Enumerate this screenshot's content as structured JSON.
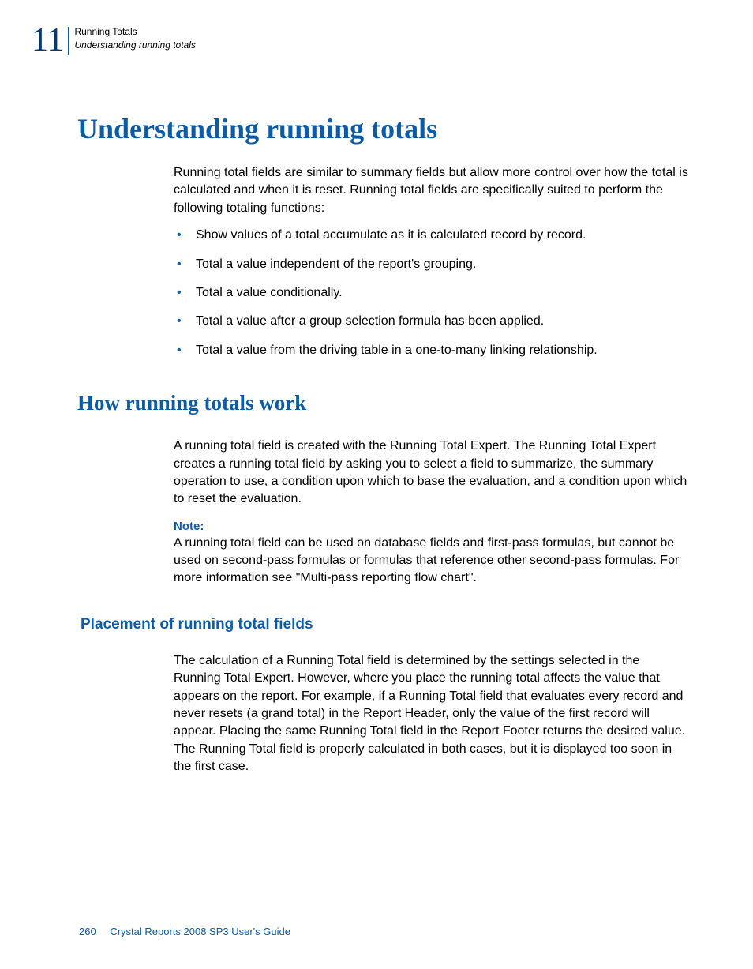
{
  "header": {
    "chapter_number": "11",
    "line1": "Running Totals",
    "line2": "Understanding running totals"
  },
  "title": "Understanding running totals",
  "intro": "Running total fields are similar to summary fields but allow more control over how the total is calculated and when it is reset. Running total fields are specifically suited to perform the following totaling functions:",
  "bullets": [
    "Show values of a total accumulate as it is calculated record by record.",
    "Total a value independent of the report's grouping.",
    "Total a value conditionally.",
    "Total a value after a group selection formula has been applied.",
    "Total a value from the driving table in a one-to-many linking relationship."
  ],
  "section2": {
    "title": "How running totals work",
    "para": "A running total field is created with the Running Total Expert. The Running Total Expert creates a running total field by asking you to select a field to summarize, the summary operation to use, a condition upon which to base the evaluation, and a condition upon which to reset the evaluation.",
    "note_label": "Note:",
    "note_body": "A running total field can be used on database fields and first-pass formulas, but cannot be used on second-pass formulas or formulas that reference other second-pass formulas. For more information see \"Multi-pass reporting flow chart\"."
  },
  "section3": {
    "title": "Placement of running total fields",
    "para": "The calculation of a Running Total field is determined by the settings selected in the Running Total Expert. However, where you place the running total affects the value that appears on the report. For example, if a Running Total field that evaluates every record and never resets (a grand total) in the Report Header, only the value of the first record will appear. Placing the same Running Total field in the Report Footer returns the desired value. The Running Total field is properly calculated in both cases, but it is displayed too soon in the first case."
  },
  "footer": {
    "page": "260",
    "book": "Crystal Reports 2008 SP3 User's Guide"
  }
}
